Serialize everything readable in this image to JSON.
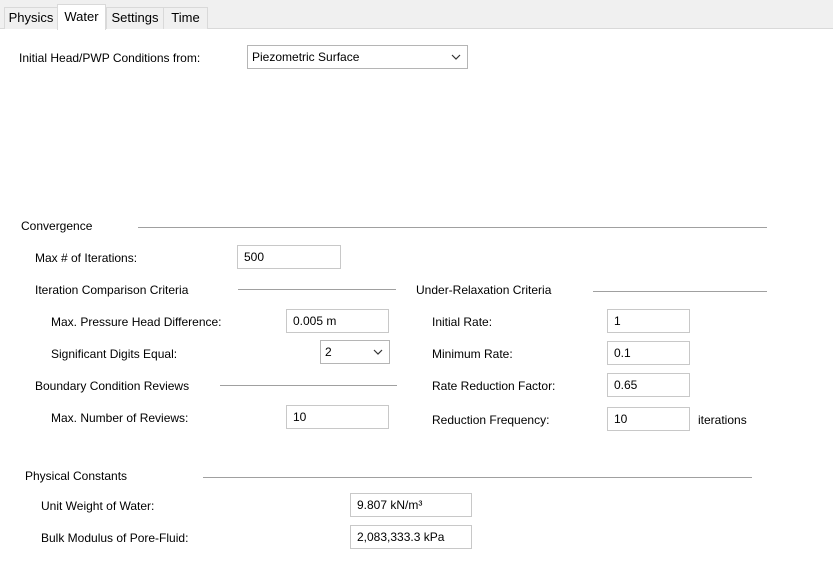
{
  "tabs": [
    {
      "label": "Physics"
    },
    {
      "label": "Water"
    },
    {
      "label": "Settings"
    },
    {
      "label": "Time"
    }
  ],
  "initial_conditions": {
    "label": "Initial Head/PWP Conditions from:",
    "value": "Piezometric Surface"
  },
  "convergence": {
    "title": "Convergence",
    "max_iterations_label": "Max # of Iterations:",
    "max_iterations_value": "500",
    "iteration_comparison": {
      "title": "Iteration Comparison Criteria",
      "pressure_head_label": "Max. Pressure Head Difference:",
      "pressure_head_value": "0.005 m",
      "sig_digits_label": "Significant Digits Equal:",
      "sig_digits_value": "2"
    },
    "boundary_reviews": {
      "title": "Boundary Condition Reviews",
      "max_reviews_label": "Max. Number of Reviews:",
      "max_reviews_value": "10"
    },
    "under_relaxation": {
      "title": "Under-Relaxation Criteria",
      "initial_rate_label": "Initial Rate:",
      "initial_rate_value": "1",
      "minimum_rate_label": "Minimum Rate:",
      "minimum_rate_value": "0.1",
      "reduction_factor_label": "Rate Reduction Factor:",
      "reduction_factor_value": "0.65",
      "reduction_frequency_label": "Reduction Frequency:",
      "reduction_frequency_value": "10",
      "reduction_frequency_unit": "iterations"
    }
  },
  "physical_constants": {
    "title": "Physical Constants",
    "unit_weight_label": "Unit Weight of Water:",
    "unit_weight_value": "9.807 kN/m³",
    "bulk_modulus_label": "Bulk Modulus of Pore-Fluid:",
    "bulk_modulus_value": "2,083,333.3 kPa"
  }
}
